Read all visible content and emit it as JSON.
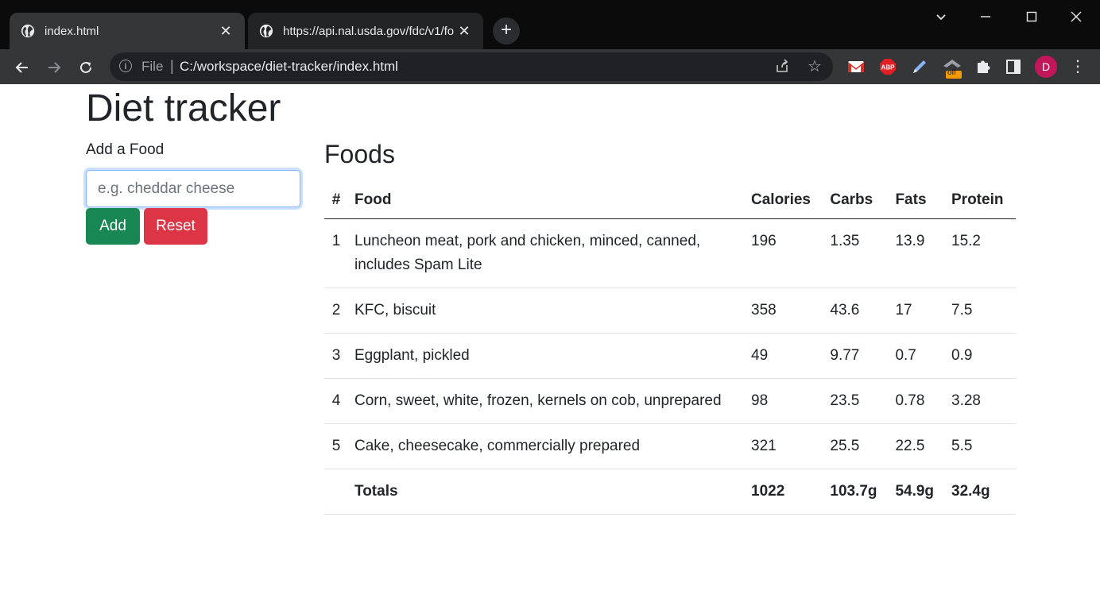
{
  "browser": {
    "tabs": [
      {
        "title": "index.html",
        "active": true
      },
      {
        "title": "https://api.nal.usda.gov/fdc/v1/fo",
        "active": false
      }
    ],
    "new_tab": "+",
    "address": {
      "scheme": "File",
      "url": "C:/workspace/diet-tracker/index.html"
    },
    "extensions": [
      "gmail-icon",
      "adblock-plus-icon",
      "pen-icon",
      "hat-icon",
      "puzzle-icon",
      "sidepanel-icon"
    ],
    "ext_badge": "off",
    "avatar_initial": "D",
    "colors": {
      "tab_active": "#353638",
      "frame": "#0b0b0c",
      "avatar": "#c2185b"
    }
  },
  "page": {
    "title": "Diet tracker",
    "add_label": "Add a Food",
    "input_placeholder": "e.g. cheddar cheese",
    "add_button": "Add",
    "reset_button": "Reset",
    "foods_heading": "Foods",
    "colors": {
      "add": "#198754",
      "reset": "#dc3545"
    }
  },
  "table": {
    "headers": [
      "#",
      "Food",
      "Calories",
      "Carbs",
      "Fats",
      "Protein"
    ],
    "rows": [
      {
        "n": "1",
        "food": "Luncheon meat, pork and chicken, minced, canned, includes Spam Lite",
        "calories": "196",
        "carbs": "1.35",
        "fats": "13.9",
        "protein": "15.2"
      },
      {
        "n": "2",
        "food": "KFC, biscuit",
        "calories": "358",
        "carbs": "43.6",
        "fats": "17",
        "protein": "7.5"
      },
      {
        "n": "3",
        "food": "Eggplant, pickled",
        "calories": "49",
        "carbs": "9.77",
        "fats": "0.7",
        "protein": "0.9"
      },
      {
        "n": "4",
        "food": "Corn, sweet, white, frozen, kernels on cob, unprepared",
        "calories": "98",
        "carbs": "23.5",
        "fats": "0.78",
        "protein": "3.28"
      },
      {
        "n": "5",
        "food": "Cake, cheesecake, commercially prepared",
        "calories": "321",
        "carbs": "25.5",
        "fats": "22.5",
        "protein": "5.5"
      }
    ],
    "totals": {
      "label": "Totals",
      "calories": "1022",
      "carbs": "103.7g",
      "fats": "54.9g",
      "protein": "32.4g"
    }
  }
}
